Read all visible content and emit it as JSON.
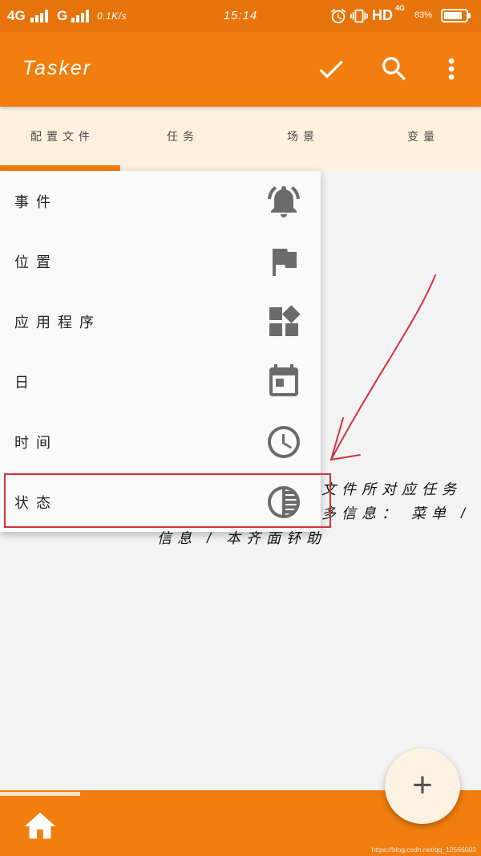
{
  "status_bar": {
    "network1": "4G",
    "network2": "G",
    "speed": "0.1K/s",
    "time": "15:14",
    "hd": "HD",
    "network_small": "4G",
    "battery": "83%",
    "icons": [
      "alarm-icon",
      "vibrate-icon"
    ]
  },
  "app_bar": {
    "title": "Tasker",
    "actions": [
      "check-icon",
      "search-icon",
      "more-vert-icon"
    ]
  },
  "tabs": [
    {
      "label": "配置文件",
      "active": true
    },
    {
      "label": "任务",
      "active": false
    },
    {
      "label": "场景",
      "active": false
    },
    {
      "label": "变量",
      "active": false
    }
  ],
  "menu": {
    "items": [
      {
        "label": "事件",
        "icon": "bell-icon"
      },
      {
        "label": "位置",
        "icon": "flag-icon"
      },
      {
        "label": "应用程序",
        "icon": "apps-icon"
      },
      {
        "label": "日",
        "icon": "calendar-icon"
      },
      {
        "label": "时间",
        "icon": "clock-icon"
      },
      {
        "label": "状态",
        "icon": "state-icon",
        "highlighted": true
      }
    ]
  },
  "annotation": {
    "lines": [
      "文件所对应任务",
      "多信息： 菜单 /",
      "信息 / 本齐面钚助"
    ]
  },
  "fab": {
    "label": "+"
  },
  "bottom_bar": {
    "icon": "home-icon"
  },
  "watermark": "https://blog.csdn.net/qq_12566003",
  "colors": {
    "accent": "#F17E0E",
    "status": "#E7740B",
    "tabbar": "#FDF0DF",
    "content": "#F3F3F3",
    "menu": "#FAFAFA",
    "icon": "#6B6B6B",
    "highlight": "#D3313B",
    "fab": "#FDF1E1"
  }
}
